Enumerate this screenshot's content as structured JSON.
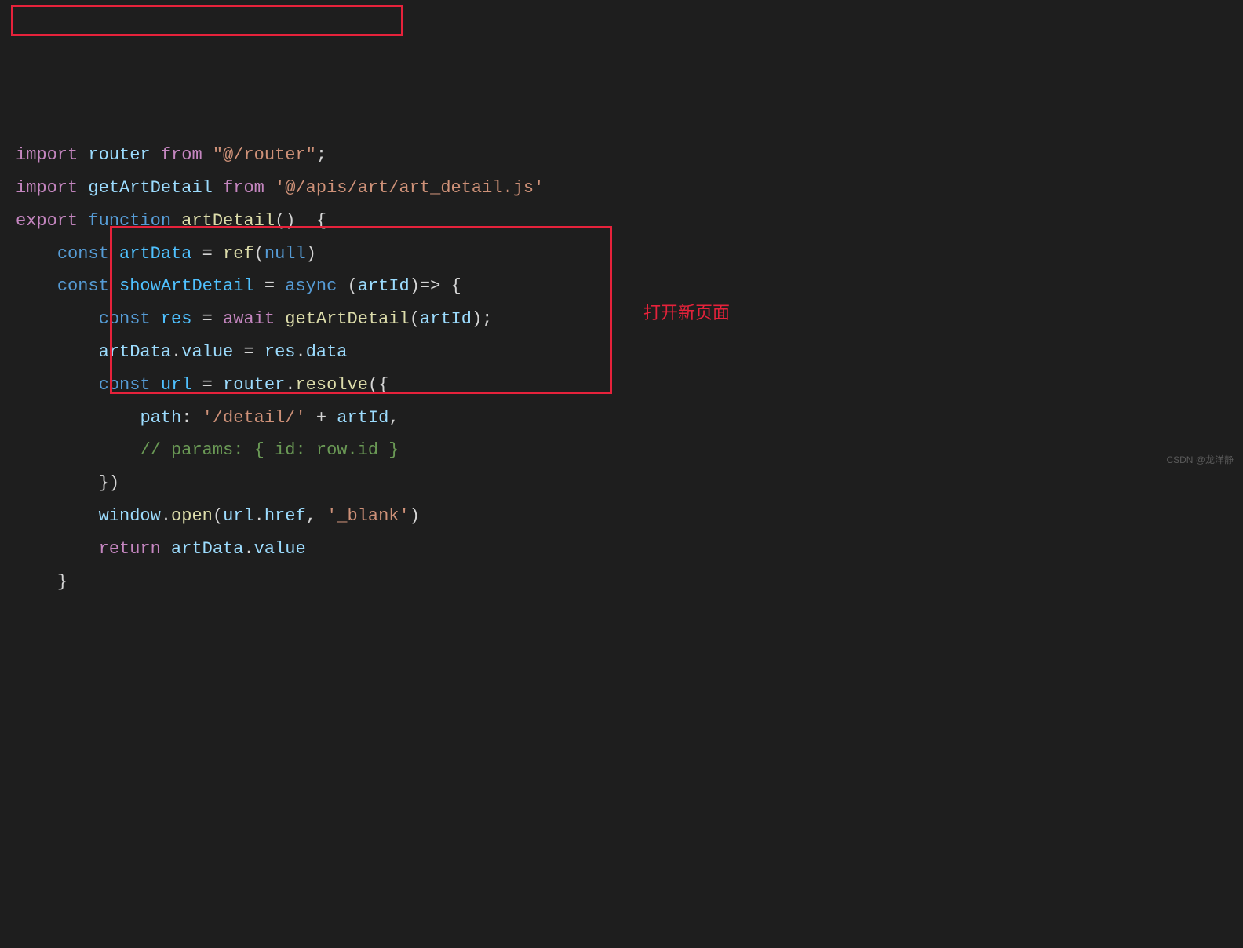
{
  "code": {
    "l1": {
      "import": "import",
      "router": "router",
      "from": "from",
      "str": "\"@/router\"",
      "semi": ";"
    },
    "l2": {
      "import": "import",
      "name": "getArtDetail",
      "from": "from",
      "str": "'@/apis/art/art_detail.js'"
    },
    "l3": {
      "export": "export",
      "func": "function",
      "name": "artDetail",
      "paren": "()  {"
    },
    "l4": {
      "decl": "const",
      "name": "artData",
      "eq": " = ",
      "call": "ref",
      "p1": "(",
      "null": "null",
      "p2": ")"
    },
    "l5": {
      "decl": "const",
      "name": "showArtDetail",
      "eq": " = ",
      "async": "async",
      "sp": " ",
      "p1": "(",
      "param": "artId",
      "p2": ")=> {"
    },
    "l6": {
      "decl": "const",
      "name": "res",
      "eq": " = ",
      "await": "await",
      "sp": " ",
      "call": "getArtDetail",
      "p1": "(",
      "arg": "artId",
      "p2": ");"
    },
    "l7": {
      "obj": "artData",
      "dot1": ".",
      "prop": "value",
      "eq": " = ",
      "obj2": "res",
      "dot2": ".",
      "prop2": "data"
    },
    "l8": {
      "decl": "const",
      "name": "url",
      "eq": " = ",
      "obj": "router",
      "dot": ".",
      "call": "resolve",
      "p1": "({"
    },
    "l9": {
      "prop": "path",
      "colon": ": ",
      "str": "'/detail/'",
      "plus": " + ",
      "var": "artId",
      "comma": ","
    },
    "l10": {
      "comment": "// params: { id: row.id }"
    },
    "l11": {
      "close": "})"
    },
    "l12": {
      "obj": "window",
      "dot": ".",
      "call": "open",
      "p1": "(",
      "arg1a": "url",
      "dot2": ".",
      "arg1b": "href",
      "comma": ", ",
      "str": "'_blank'",
      "p2": ")"
    },
    "l13": {
      "return": "return",
      "sp": " ",
      "obj": "artData",
      "dot": ".",
      "prop": "value"
    },
    "l14": {
      "close": "}"
    }
  },
  "annotation": "打开新页面",
  "watermark": "CSDN @龙洋静"
}
